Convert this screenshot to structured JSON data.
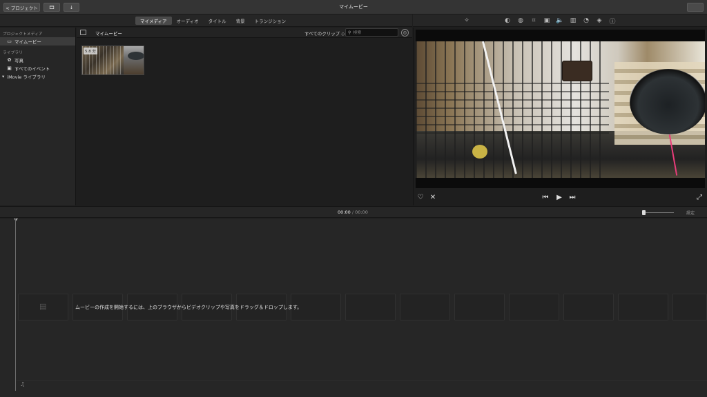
{
  "titlebar": {
    "back_label": "< プロジェクト",
    "window_title": "マイムービー"
  },
  "browser_tabs": [
    "マイメディア",
    "オーディオ",
    "タイトル",
    "背景",
    "トランジション"
  ],
  "sidebar": {
    "project_media_header": "プロジェクトメディア",
    "project_item": "マイムービー",
    "library_header": "ライブラリ",
    "items": [
      {
        "label": "写真",
        "icon": "photos-icon"
      },
      {
        "label": "すべてのイベント",
        "icon": "events-icon"
      }
    ],
    "library_name": "iMovie ライブラリ"
  },
  "browser": {
    "title": "マイムービー",
    "filter_label": "すべてのクリップ ◇",
    "search_placeholder": "検索",
    "clip_duration": "5.8 分"
  },
  "timeline": {
    "current_time": "00:00",
    "separator": "/",
    "total_time": "00:00",
    "settings_label": "設定",
    "hint": "ムービーの作成を開始するには、上のブラウザからビデオクリップや写真をドラッグ＆ドロップします。"
  },
  "colors": {
    "background": "#1e1e1e",
    "panel": "#262626",
    "titlebar": "#343434",
    "selected_tab": "#4a4a4a"
  }
}
